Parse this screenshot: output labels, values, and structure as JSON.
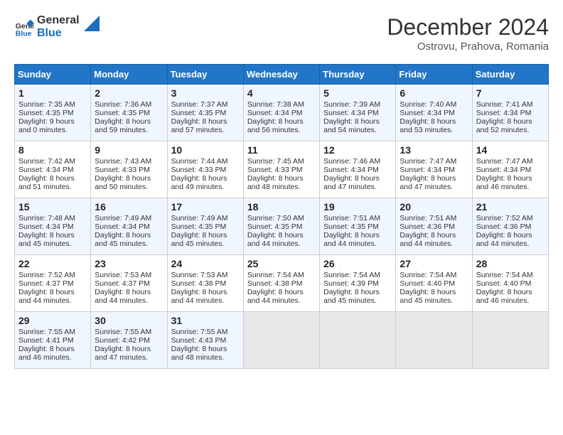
{
  "header": {
    "logo_line1": "General",
    "logo_line2": "Blue",
    "month_title": "December 2024",
    "subtitle": "Ostrovu, Prahova, Romania"
  },
  "days_of_week": [
    "Sunday",
    "Monday",
    "Tuesday",
    "Wednesday",
    "Thursday",
    "Friday",
    "Saturday"
  ],
  "weeks": [
    [
      {
        "day": "1",
        "sunrise": "Sunrise: 7:35 AM",
        "sunset": "Sunset: 4:35 PM",
        "daylight": "Daylight: 9 hours and 0 minutes."
      },
      {
        "day": "2",
        "sunrise": "Sunrise: 7:36 AM",
        "sunset": "Sunset: 4:35 PM",
        "daylight": "Daylight: 8 hours and 59 minutes."
      },
      {
        "day": "3",
        "sunrise": "Sunrise: 7:37 AM",
        "sunset": "Sunset: 4:35 PM",
        "daylight": "Daylight: 8 hours and 57 minutes."
      },
      {
        "day": "4",
        "sunrise": "Sunrise: 7:38 AM",
        "sunset": "Sunset: 4:34 PM",
        "daylight": "Daylight: 8 hours and 56 minutes."
      },
      {
        "day": "5",
        "sunrise": "Sunrise: 7:39 AM",
        "sunset": "Sunset: 4:34 PM",
        "daylight": "Daylight: 8 hours and 54 minutes."
      },
      {
        "day": "6",
        "sunrise": "Sunrise: 7:40 AM",
        "sunset": "Sunset: 4:34 PM",
        "daylight": "Daylight: 8 hours and 53 minutes."
      },
      {
        "day": "7",
        "sunrise": "Sunrise: 7:41 AM",
        "sunset": "Sunset: 4:34 PM",
        "daylight": "Daylight: 8 hours and 52 minutes."
      }
    ],
    [
      {
        "day": "8",
        "sunrise": "Sunrise: 7:42 AM",
        "sunset": "Sunset: 4:34 PM",
        "daylight": "Daylight: 8 hours and 51 minutes."
      },
      {
        "day": "9",
        "sunrise": "Sunrise: 7:43 AM",
        "sunset": "Sunset: 4:33 PM",
        "daylight": "Daylight: 8 hours and 50 minutes."
      },
      {
        "day": "10",
        "sunrise": "Sunrise: 7:44 AM",
        "sunset": "Sunset: 4:33 PM",
        "daylight": "Daylight: 8 hours and 49 minutes."
      },
      {
        "day": "11",
        "sunrise": "Sunrise: 7:45 AM",
        "sunset": "Sunset: 4:33 PM",
        "daylight": "Daylight: 8 hours and 48 minutes."
      },
      {
        "day": "12",
        "sunrise": "Sunrise: 7:46 AM",
        "sunset": "Sunset: 4:34 PM",
        "daylight": "Daylight: 8 hours and 47 minutes."
      },
      {
        "day": "13",
        "sunrise": "Sunrise: 7:47 AM",
        "sunset": "Sunset: 4:34 PM",
        "daylight": "Daylight: 8 hours and 47 minutes."
      },
      {
        "day": "14",
        "sunrise": "Sunrise: 7:47 AM",
        "sunset": "Sunset: 4:34 PM",
        "daylight": "Daylight: 8 hours and 46 minutes."
      }
    ],
    [
      {
        "day": "15",
        "sunrise": "Sunrise: 7:48 AM",
        "sunset": "Sunset: 4:34 PM",
        "daylight": "Daylight: 8 hours and 45 minutes."
      },
      {
        "day": "16",
        "sunrise": "Sunrise: 7:49 AM",
        "sunset": "Sunset: 4:34 PM",
        "daylight": "Daylight: 8 hours and 45 minutes."
      },
      {
        "day": "17",
        "sunrise": "Sunrise: 7:49 AM",
        "sunset": "Sunset: 4:35 PM",
        "daylight": "Daylight: 8 hours and 45 minutes."
      },
      {
        "day": "18",
        "sunrise": "Sunrise: 7:50 AM",
        "sunset": "Sunset: 4:35 PM",
        "daylight": "Daylight: 8 hours and 44 minutes."
      },
      {
        "day": "19",
        "sunrise": "Sunrise: 7:51 AM",
        "sunset": "Sunset: 4:35 PM",
        "daylight": "Daylight: 8 hours and 44 minutes."
      },
      {
        "day": "20",
        "sunrise": "Sunrise: 7:51 AM",
        "sunset": "Sunset: 4:36 PM",
        "daylight": "Daylight: 8 hours and 44 minutes."
      },
      {
        "day": "21",
        "sunrise": "Sunrise: 7:52 AM",
        "sunset": "Sunset: 4:36 PM",
        "daylight": "Daylight: 8 hours and 44 minutes."
      }
    ],
    [
      {
        "day": "22",
        "sunrise": "Sunrise: 7:52 AM",
        "sunset": "Sunset: 4:37 PM",
        "daylight": "Daylight: 8 hours and 44 minutes."
      },
      {
        "day": "23",
        "sunrise": "Sunrise: 7:53 AM",
        "sunset": "Sunset: 4:37 PM",
        "daylight": "Daylight: 8 hours and 44 minutes."
      },
      {
        "day": "24",
        "sunrise": "Sunrise: 7:53 AM",
        "sunset": "Sunset: 4:38 PM",
        "daylight": "Daylight: 8 hours and 44 minutes."
      },
      {
        "day": "25",
        "sunrise": "Sunrise: 7:54 AM",
        "sunset": "Sunset: 4:38 PM",
        "daylight": "Daylight: 8 hours and 44 minutes."
      },
      {
        "day": "26",
        "sunrise": "Sunrise: 7:54 AM",
        "sunset": "Sunset: 4:39 PM",
        "daylight": "Daylight: 8 hours and 45 minutes."
      },
      {
        "day": "27",
        "sunrise": "Sunrise: 7:54 AM",
        "sunset": "Sunset: 4:40 PM",
        "daylight": "Daylight: 8 hours and 45 minutes."
      },
      {
        "day": "28",
        "sunrise": "Sunrise: 7:54 AM",
        "sunset": "Sunset: 4:40 PM",
        "daylight": "Daylight: 8 hours and 46 minutes."
      }
    ],
    [
      {
        "day": "29",
        "sunrise": "Sunrise: 7:55 AM",
        "sunset": "Sunset: 4:41 PM",
        "daylight": "Daylight: 8 hours and 46 minutes."
      },
      {
        "day": "30",
        "sunrise": "Sunrise: 7:55 AM",
        "sunset": "Sunset: 4:42 PM",
        "daylight": "Daylight: 8 hours and 47 minutes."
      },
      {
        "day": "31",
        "sunrise": "Sunrise: 7:55 AM",
        "sunset": "Sunset: 4:43 PM",
        "daylight": "Daylight: 8 hours and 48 minutes."
      },
      null,
      null,
      null,
      null
    ]
  ]
}
